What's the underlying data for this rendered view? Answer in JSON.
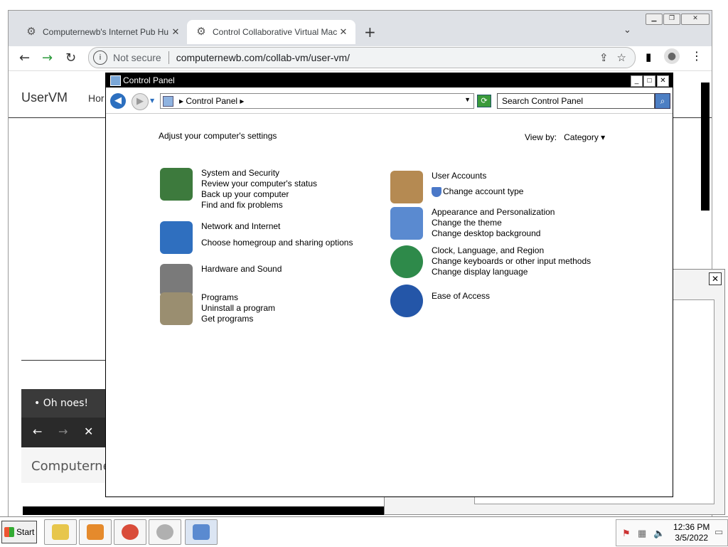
{
  "browser": {
    "tabs": [
      {
        "title": "Computernewb's Internet Pub Hu",
        "close": "✕"
      },
      {
        "title": "Control Collaborative Virtual Mac",
        "close": "✕"
      }
    ],
    "new_tab": "+",
    "tab_menu": "⌄",
    "window_buttons": {
      "minimize": "▁",
      "restore": "❐",
      "close": "✕"
    },
    "nav": {
      "back": "←",
      "forward": "→",
      "reload": "↻"
    },
    "address": {
      "security": "Not secure",
      "url": "computernewb.com/collab-vm/user-vm/",
      "info_glyph": "i"
    },
    "actions": {
      "share": "⇪",
      "bookmark": "☆",
      "side_panel": "▮",
      "profile": "●",
      "menu": "⋮"
    }
  },
  "page": {
    "brand": "UserVM",
    "home_link": "Hor",
    "toast": "• Oh noes!",
    "vm_controls": {
      "back": "←",
      "forward": "→",
      "close": "✕"
    },
    "partial_text": "Computerne"
  },
  "bg_dialog": {
    "close": "✕"
  },
  "control_panel": {
    "title": "Control Panel",
    "buttons": {
      "minimize": "_",
      "maximize": "□",
      "close": "✕"
    },
    "nav": {
      "back": "◀",
      "forward": "▶",
      "recent": "▼"
    },
    "breadcrumb": "▸ Control Panel ▸",
    "breadcrumb_dd": "▼",
    "refresh": "⟳",
    "search_placeholder": "Search Control Panel",
    "search_icon": "⌕",
    "heading": "Adjust your computer's settings",
    "view_by_label": "View by:",
    "view_by_value": "Category ▾",
    "categories_left": [
      {
        "title": "System and Security",
        "links": [
          "Review your computer's status",
          "Back up your computer",
          "Find and fix problems"
        ]
      },
      {
        "title": "Network and Internet",
        "links": [
          "Choose homegroup and sharing options"
        ]
      },
      {
        "title": "Hardware and Sound",
        "links": []
      },
      {
        "title": "Programs",
        "links": [
          "Uninstall a program",
          "Get programs"
        ]
      }
    ],
    "categories_right": [
      {
        "title": "User Accounts",
        "links": [
          "Change account type"
        ]
      },
      {
        "title": "Appearance and Personalization",
        "links": [
          "Change the theme",
          "Change desktop background"
        ]
      },
      {
        "title": "Clock, Language, and Region",
        "links": [
          "Change keyboards or other input methods",
          "Change display language"
        ]
      },
      {
        "title": "Ease of Access",
        "links": []
      }
    ],
    "icon_colors": {
      "security": "#3d7a3d",
      "network": "#2f6fbf",
      "hardware": "#7a7a7a",
      "programs": "#9a8e70",
      "users": "#b58a52",
      "appearance": "#5a8ad0",
      "clock": "#2e8a4a",
      "ease": "#2456a8"
    }
  },
  "taskbar": {
    "start": "Start",
    "clock_time": "12:36 PM",
    "clock_date": "3/5/2022",
    "app_colors": [
      "#e7c64c",
      "#e58a2c",
      "#d94c3a",
      "#b0b0b0",
      "#5a8ad0"
    ]
  }
}
